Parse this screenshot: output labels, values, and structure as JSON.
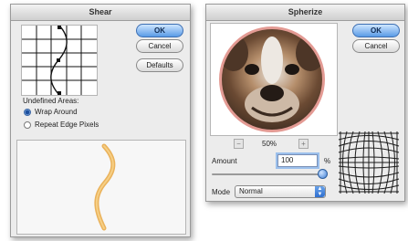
{
  "shear": {
    "title": "Shear",
    "ok_label": "OK",
    "cancel_label": "Cancel",
    "defaults_label": "Defaults",
    "undefined_areas_label": "Undefined Areas:",
    "options": [
      {
        "label": "Wrap Around",
        "selected": true
      },
      {
        "label": "Repeat Edge Pixels",
        "selected": false
      }
    ]
  },
  "spherize": {
    "title": "Spherize",
    "ok_label": "OK",
    "cancel_label": "Cancel",
    "zoom_out_symbol": "−",
    "zoom_in_symbol": "+",
    "zoom_level": "50%",
    "amount_label": "Amount",
    "amount_value": "100",
    "amount_unit": "%",
    "amount_slider_fraction": 1.0,
    "mode_label": "Mode",
    "mode_value": "Normal"
  },
  "colors": {
    "accent": "#5a9be6",
    "preview_ring": "#e39a93",
    "shear_curve": "#e7a63f"
  }
}
